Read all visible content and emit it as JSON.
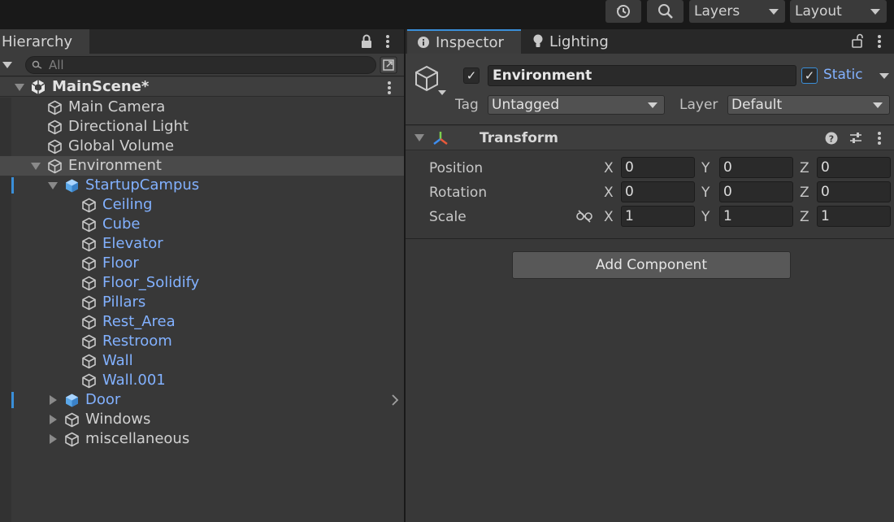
{
  "toolbar": {
    "layers_label": "Layers",
    "layout_label": "Layout",
    "history_icon": "history-icon",
    "search_icon": "search-icon"
  },
  "hierarchy": {
    "tab_label": "Hierarchy",
    "search_placeholder": "All",
    "scene_name": "MainScene*",
    "items": [
      {
        "label": "Main Camera",
        "type": "gameobject"
      },
      {
        "label": "Directional Light",
        "type": "gameobject"
      },
      {
        "label": "Global Volume",
        "type": "gameobject"
      },
      {
        "label": "Environment",
        "type": "gameobject",
        "selected": true,
        "expanded": true
      },
      {
        "label": "StartupCampus",
        "type": "prefab",
        "expanded": true
      },
      {
        "label": "Ceiling",
        "type": "prefab-child"
      },
      {
        "label": "Cube",
        "type": "prefab-child"
      },
      {
        "label": "Elevator",
        "type": "prefab-child"
      },
      {
        "label": "Floor",
        "type": "prefab-child"
      },
      {
        "label": "Floor_Solidify",
        "type": "prefab-child"
      },
      {
        "label": "Pillars",
        "type": "prefab-child"
      },
      {
        "label": "Rest_Area",
        "type": "prefab-child"
      },
      {
        "label": "Restroom",
        "type": "prefab-child"
      },
      {
        "label": "Wall",
        "type": "prefab-child"
      },
      {
        "label": "Wall.001",
        "type": "prefab-child"
      },
      {
        "label": "Door",
        "type": "prefab",
        "collapsed": true
      },
      {
        "label": "Windows",
        "type": "gameobject",
        "collapsed": true
      },
      {
        "label": "miscellaneous",
        "type": "gameobject",
        "collapsed": true
      }
    ]
  },
  "inspector": {
    "tabs": [
      {
        "label": "Inspector",
        "icon": "info-icon",
        "active": true
      },
      {
        "label": "Lighting",
        "icon": "bulb-icon",
        "active": false
      }
    ],
    "object_name": "Environment",
    "active": true,
    "static_label": "Static",
    "static_checked": true,
    "tag_label": "Tag",
    "tag_value": "Untagged",
    "layer_label": "Layer",
    "layer_value": "Default",
    "transform": {
      "title": "Transform",
      "rows": [
        {
          "label": "Position",
          "x": "0",
          "y": "0",
          "z": "0"
        },
        {
          "label": "Rotation",
          "x": "0",
          "y": "0",
          "z": "0"
        },
        {
          "label": "Scale",
          "x": "1",
          "y": "1",
          "z": "1"
        }
      ],
      "axis_x": "X",
      "axis_y": "Y",
      "axis_z": "Z"
    },
    "add_component_label": "Add Component"
  },
  "colors": {
    "prefab_text": "#82b1ff",
    "selection_mark": "#3a8fd9",
    "background": "#383838"
  }
}
